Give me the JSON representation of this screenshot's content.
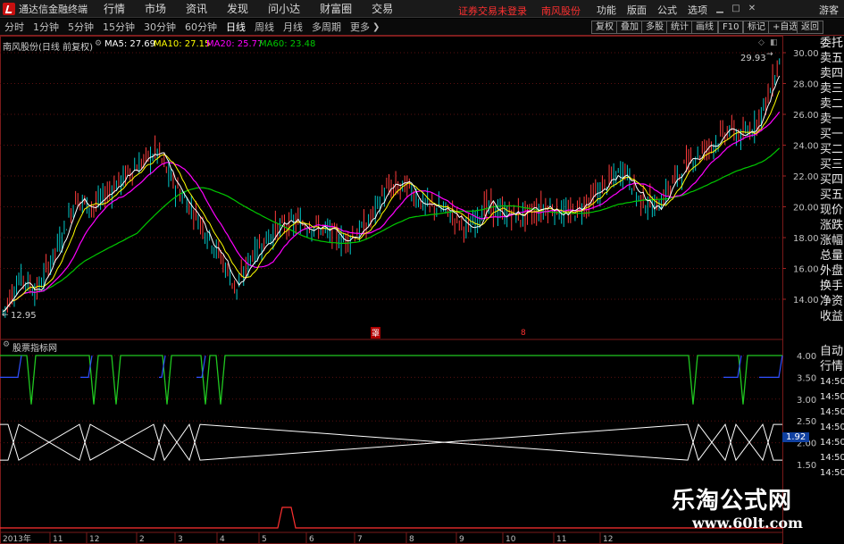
{
  "menubar": {
    "app_title": "通达信金融终端",
    "items": [
      "行情",
      "市场",
      "资讯",
      "发现",
      "问小达",
      "财富圈",
      "交易"
    ],
    "status_text": "证券交易未登录",
    "stock_name": "南风股份",
    "right_items": [
      "功能",
      "版面",
      "公式",
      "选项"
    ],
    "guest": "游客"
  },
  "tabbar": {
    "tabs": [
      "分时",
      "1分钟",
      "5分钟",
      "15分钟",
      "30分钟",
      "60分钟",
      "日线",
      "周线",
      "月线",
      "多周期",
      "更多"
    ],
    "active": "日线",
    "tools": [
      "复权",
      "叠加",
      "多股",
      "统计",
      "画线",
      "F10",
      "标记",
      "+自选",
      "返回"
    ]
  },
  "main_chart": {
    "title": "南风股份(日线 前复权)",
    "ma5_label": "MA5: 27.69",
    "ma10_label": "MA10: 27.15",
    "ma20_label": "MA20: 25.77",
    "ma60_label": "MA60: 23.48",
    "high_label": "29.93",
    "low_label": "12.95",
    "y_ticks": [
      "30.00",
      "28.00",
      "26.00",
      "24.00",
      "22.00",
      "20.00",
      "18.00",
      "16.00",
      "14.00"
    ],
    "colors": {
      "ma5": "#ffffff",
      "ma10": "#ffff00",
      "ma20": "#ff00ff",
      "ma60": "#00c800",
      "up": "#ff3c3c",
      "down": "#00c8c8",
      "grid": "#5a1010"
    }
  },
  "indicator": {
    "title": "股票指标网",
    "y_ticks": [
      "4.00",
      "3.50",
      "3.00",
      "2.50",
      "2.00",
      "1.50"
    ],
    "current_value": "1.92",
    "time_labels": [
      "行情",
      "14:50",
      "14:50",
      "14:50",
      "14:50",
      "14:50",
      "14:50",
      "14:50"
    ]
  },
  "x_axis": {
    "labels": [
      "2013年",
      "11",
      "12",
      "2",
      "3",
      "4",
      "5",
      "6",
      "7",
      "8",
      "9",
      "10",
      "11",
      "12"
    ]
  },
  "side_panel": {
    "items": [
      "委托",
      "卖五",
      "卖四",
      "卖三",
      "卖二",
      "卖一",
      "买一",
      "买二",
      "买三",
      "买四",
      "买五",
      "现价",
      "涨跌",
      "涨幅",
      "总量",
      "外盘",
      "换手",
      "净资",
      "收益",
      "自动"
    ]
  },
  "markers": {
    "m1": "罩",
    "m2": "8"
  },
  "watermark": {
    "line1": "乐淘公式网",
    "line2": "www.60lt.com"
  }
}
